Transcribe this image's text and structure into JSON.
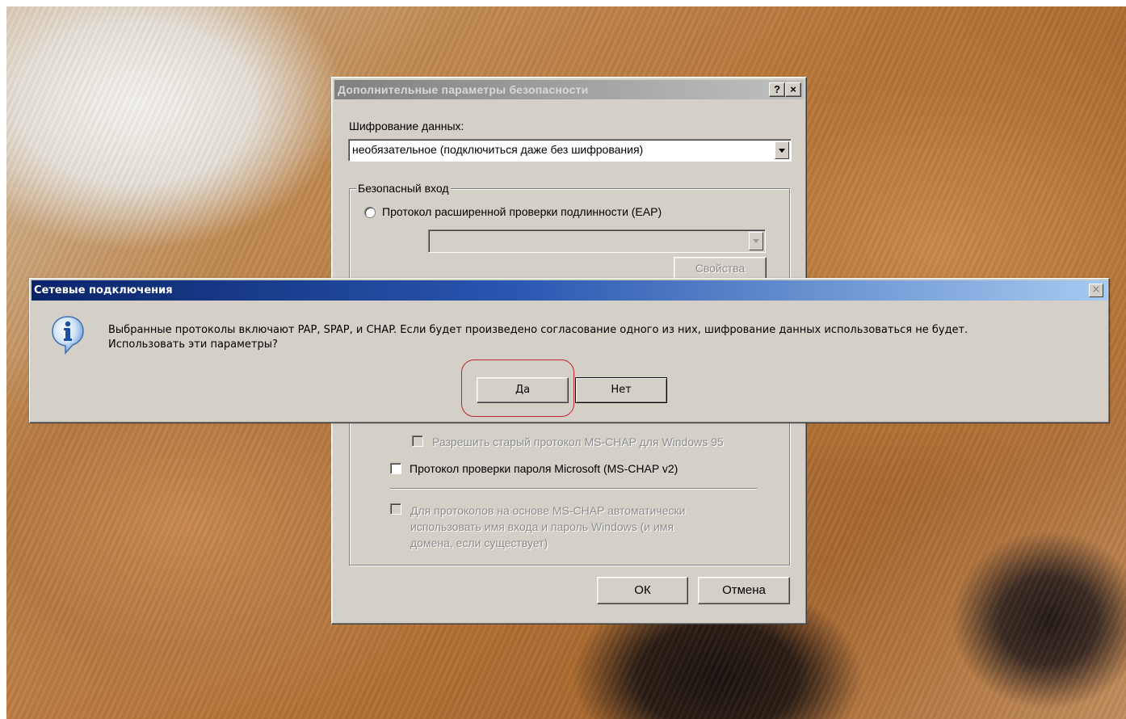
{
  "back_dialog": {
    "title": "Дополнительные параметры безопасности",
    "help_button": "?",
    "close_button": "×",
    "encryption_label": "Шифрование данных:",
    "encryption_value": "необязательное (подключиться даже без шифрования)",
    "secure_logon_group": "Безопасный вход",
    "eap_radio_label": "Протокол расширенной проверки подлинности (EAP)",
    "eap_combo_value": "",
    "properties_button": "Свойства",
    "allow_old_mschap": "Разрешить старый протокол MS-CHAP для Windows 95",
    "mschap_v2": "Протокол проверки пароля Microsoft (MS-CHAP v2)",
    "auto_logon_line1": "Для протоколов на основе MS-CHAP автоматически",
    "auto_logon_line2": "использовать имя входа и пароль Windows (и имя",
    "auto_logon_line3": "домена, если существует)",
    "ok_button": "ОК",
    "cancel_button": "Отмена"
  },
  "message_box": {
    "title": "Сетевые подключения",
    "close_button": "×",
    "icon": "info-icon",
    "message_line1": "Выбранные протоколы включают PAP, SPAP, и CHAP. Если будет произведено согласование одного из них, шифрование данных использоваться не будет.",
    "message_line2": "Использовать эти параметры?",
    "yes_button": "Да",
    "no_button": "Нет"
  },
  "colors": {
    "title_active_start": "#0a246a",
    "title_active_end": "#a6caf0",
    "dialog_face": "#d4d0c8",
    "highlight_ring": "#c0262e"
  }
}
